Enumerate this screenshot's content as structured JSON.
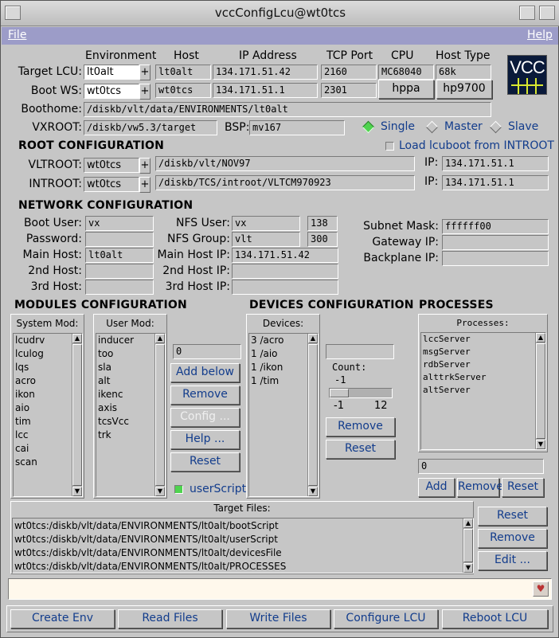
{
  "window": {
    "title": "vccConfigLcu@wt0tcs"
  },
  "menu": {
    "file": "File",
    "help": "Help"
  },
  "header_cols": {
    "environment": "Environment",
    "host": "Host",
    "ip": "IP Address",
    "tcp": "TCP Port",
    "cpu": "CPU",
    "hosttype": "Host Type"
  },
  "logo": {
    "text": "VCC"
  },
  "target_lcu": {
    "label": "Target LCU:",
    "env": "lt0alt",
    "host": "lt0alt",
    "ip": "134.171.51.42",
    "port": "2160",
    "cpu": "MC68040",
    "hosttype": "68k"
  },
  "boot_ws": {
    "label": "Boot WS:",
    "env": "wt0tcs",
    "host": "wt0tcs",
    "ip": "134.171.51.1",
    "port": "2301",
    "cpu": "hppa",
    "hosttype": "hp9700"
  },
  "plus": "+",
  "boothome": {
    "label": "Boothome:",
    "value": "/diskb/vlt/data/ENVIRONMENTS/lt0alt"
  },
  "vxroot": {
    "label": "VXROOT:",
    "value": "/diskb/vw5.3/target",
    "bsp_label": "BSP:",
    "bsp": "mv167"
  },
  "mode": {
    "single": "Single",
    "master": "Master",
    "slave": "Slave",
    "selected": "single"
  },
  "root_config": {
    "title": "ROOT CONFIGURATION",
    "load_label": "Load lcuboot from INTROOT",
    "ip_label": "IP:",
    "vltroot": {
      "label": "VLTROOT:",
      "env": "wt0tcs",
      "path": "/diskb/vlt/NOV97",
      "ip": "134.171.51.1"
    },
    "introot": {
      "label": "INTROOT:",
      "env": "wt0tcs",
      "path": "/diskb/TCS/introot/VLTCM970923",
      "ip": "134.171.51.1"
    }
  },
  "network": {
    "title": "NETWORK CONFIGURATION",
    "boot_user_label": "Boot User:",
    "boot_user": "vx",
    "password_label": "Password:",
    "password": "",
    "main_host_label": "Main Host:",
    "main_host": "lt0alt",
    "host2_label": "2nd Host:",
    "host2": "",
    "host3_label": "3rd Host:",
    "host3": "",
    "nfs_user_label": "NFS User:",
    "nfs_user": "vx",
    "nfs_user_id": "138",
    "nfs_group_label": "NFS Group:",
    "nfs_group": "vlt",
    "nfs_group_id": "300",
    "main_ip_label": "Main Host IP:",
    "main_ip": "134.171.51.42",
    "ip2_label": "2nd Host IP:",
    "ip2": "",
    "ip3_label": "3rd Host IP:",
    "ip3": "",
    "subnet_label": "Subnet Mask:",
    "subnet": "ffffff00",
    "gateway_label": "Gateway IP:",
    "gateway": "",
    "backplane_label": "Backplane IP:",
    "backplane": ""
  },
  "modules": {
    "title": "MODULES CONFIGURATION",
    "system_title": "System Mod:",
    "system": [
      "lcudrv",
      "lculog",
      "lqs",
      "acro",
      "ikon",
      "aio",
      "tim",
      "lcc",
      "cai",
      "scan"
    ],
    "user_title": "User Mod:",
    "user": [
      "inducer",
      "too",
      "sla",
      "alt",
      "ikenc",
      "axis",
      "tcsVcc",
      "trk"
    ],
    "index": "0",
    "add_below": "Add below",
    "remove": "Remove",
    "config": "Config ...",
    "help": "Help ...",
    "reset": "Reset",
    "userscript_label": "userScript"
  },
  "devices": {
    "title": "DEVICES CONFIGURATION",
    "list_title": "Devices:",
    "items": [
      "3 /acro",
      "1 /aio",
      "1 /ikon",
      "1 /tim"
    ],
    "name_value": "",
    "count_label": "Count:",
    "count_value": "-1",
    "min": "-1",
    "max": "12",
    "slider_fraction": 0.0,
    "remove": "Remove",
    "reset": "Reset"
  },
  "processes": {
    "title": "PROCESSES",
    "list_title": "Processes:",
    "items": [
      "lccServer",
      "msgServer",
      "rdbServer",
      "alttrkServer",
      "altServer"
    ],
    "index": "0",
    "add": "Add",
    "remove": "Remove",
    "reset": "Reset"
  },
  "target_files": {
    "title": "Target Files:",
    "items": [
      "wt0tcs:/diskb/vlt/data/ENVIRONMENTS/lt0alt/bootScript",
      "wt0tcs:/diskb/vlt/data/ENVIRONMENTS/lt0alt/userScript",
      "wt0tcs:/diskb/vlt/data/ENVIRONMENTS/lt0alt/devicesFile",
      "wt0tcs:/diskb/vlt/data/ENVIRONMENTS/lt0alt/PROCESSES"
    ],
    "reset": "Reset",
    "remove": "Remove",
    "edit": "Edit ..."
  },
  "message": {
    "value": ""
  },
  "actions": {
    "create_env": "Create Env",
    "read_files": "Read Files",
    "write_files": "Write Files",
    "configure_lcu": "Configure LCU",
    "reboot_lcu": "Reboot LCU"
  },
  "colors": {
    "background": "#c6c6c6",
    "menubar": "#9c9cc8",
    "button_text": "#123c8c",
    "indicator_on": "#4fd34f",
    "message_bg": "#fff8ec"
  }
}
